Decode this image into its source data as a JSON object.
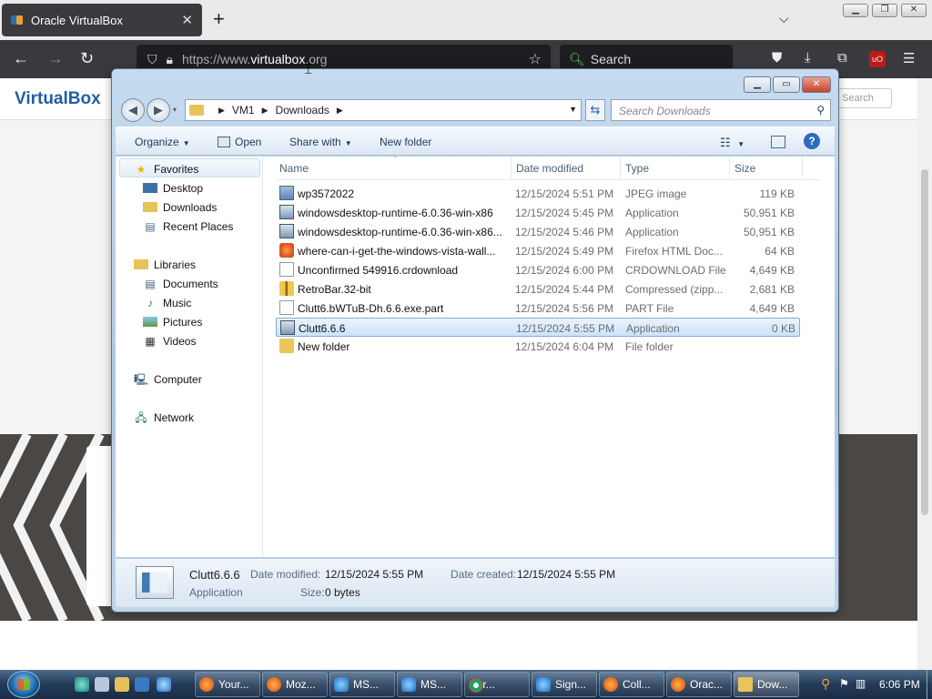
{
  "browser": {
    "tab_title": "Oracle VirtualBox",
    "tab_close": "✕",
    "new_tab": "+",
    "tab_list": "⌵",
    "url_prefix": "https://www.",
    "url_domain": "virtualbox",
    "url_suffix": ".org",
    "search_placeholder": "Search"
  },
  "website": {
    "logo": "VirtualBox",
    "search_placeholder": "Search"
  },
  "explorer": {
    "breadcrumb": [
      "VM1",
      "Downloads"
    ],
    "search_placeholder": "Search Downloads",
    "toolbar": {
      "organize": "Organize",
      "open": "Open",
      "share_with": "Share with",
      "new_folder": "New folder"
    },
    "nav_pane": {
      "favorites": "Favorites",
      "desktop": "Desktop",
      "downloads": "Downloads",
      "recent_places": "Recent Places",
      "libraries": "Libraries",
      "documents": "Documents",
      "music": "Music",
      "pictures": "Pictures",
      "videos": "Videos",
      "computer": "Computer",
      "network": "Network"
    },
    "columns": {
      "name": "Name",
      "date_modified": "Date modified",
      "type": "Type",
      "size": "Size"
    },
    "files": [
      {
        "name": "wp3572022",
        "date": "12/15/2024 5:51 PM",
        "type": "JPEG image",
        "size": "119 KB",
        "icon": "image-icon"
      },
      {
        "name": "windowsdesktop-runtime-6.0.36-win-x86",
        "date": "12/15/2024 5:45 PM",
        "type": "Application",
        "size": "50,951 KB",
        "icon": "installer-icon"
      },
      {
        "name": "windowsdesktop-runtime-6.0.36-win-x86...",
        "date": "12/15/2024 5:46 PM",
        "type": "Application",
        "size": "50,951 KB",
        "icon": "installer-icon"
      },
      {
        "name": "where-can-i-get-the-windows-vista-wall...",
        "date": "12/15/2024 5:49 PM",
        "type": "Firefox HTML Doc...",
        "size": "64 KB",
        "icon": "firefox-doc-icon"
      },
      {
        "name": "Unconfirmed 549916.crdownload",
        "date": "12/15/2024 6:00 PM",
        "type": "CRDOWNLOAD File",
        "size": "4,649 KB",
        "icon": "blank-file-icon"
      },
      {
        "name": "RetroBar.32-bit",
        "date": "12/15/2024 5:44 PM",
        "type": "Compressed (zipp...",
        "size": "2,681 KB",
        "icon": "zip-folder-icon"
      },
      {
        "name": "Clutt6.bWTuB-Dh.6.6.exe.part",
        "date": "12/15/2024 5:56 PM",
        "type": "PART File",
        "size": "4,649 KB",
        "icon": "blank-file-icon"
      },
      {
        "name": "Clutt6.6.6",
        "date": "12/15/2024 5:55 PM",
        "type": "Application",
        "size": "0 KB",
        "icon": "application-icon"
      },
      {
        "name": "New folder",
        "date": "12/15/2024 6:04 PM",
        "type": "File folder",
        "size": "",
        "icon": "folder-icon"
      }
    ],
    "details": {
      "name": "Clutt6.6.6",
      "type": "Application",
      "date_modified_label": "Date modified:",
      "date_modified": "12/15/2024 5:55 PM",
      "date_created_label": "Date created:",
      "date_created": "12/15/2024 5:55 PM",
      "size_label": "Size:",
      "size": "0 bytes"
    }
  },
  "taskbar": {
    "buttons": [
      "Your...",
      "Moz...",
      "MS...",
      "MS...",
      "Chr...",
      "Sign...",
      "Coll...",
      "Orac...",
      "Dow..."
    ],
    "time": "6:06 PM"
  }
}
